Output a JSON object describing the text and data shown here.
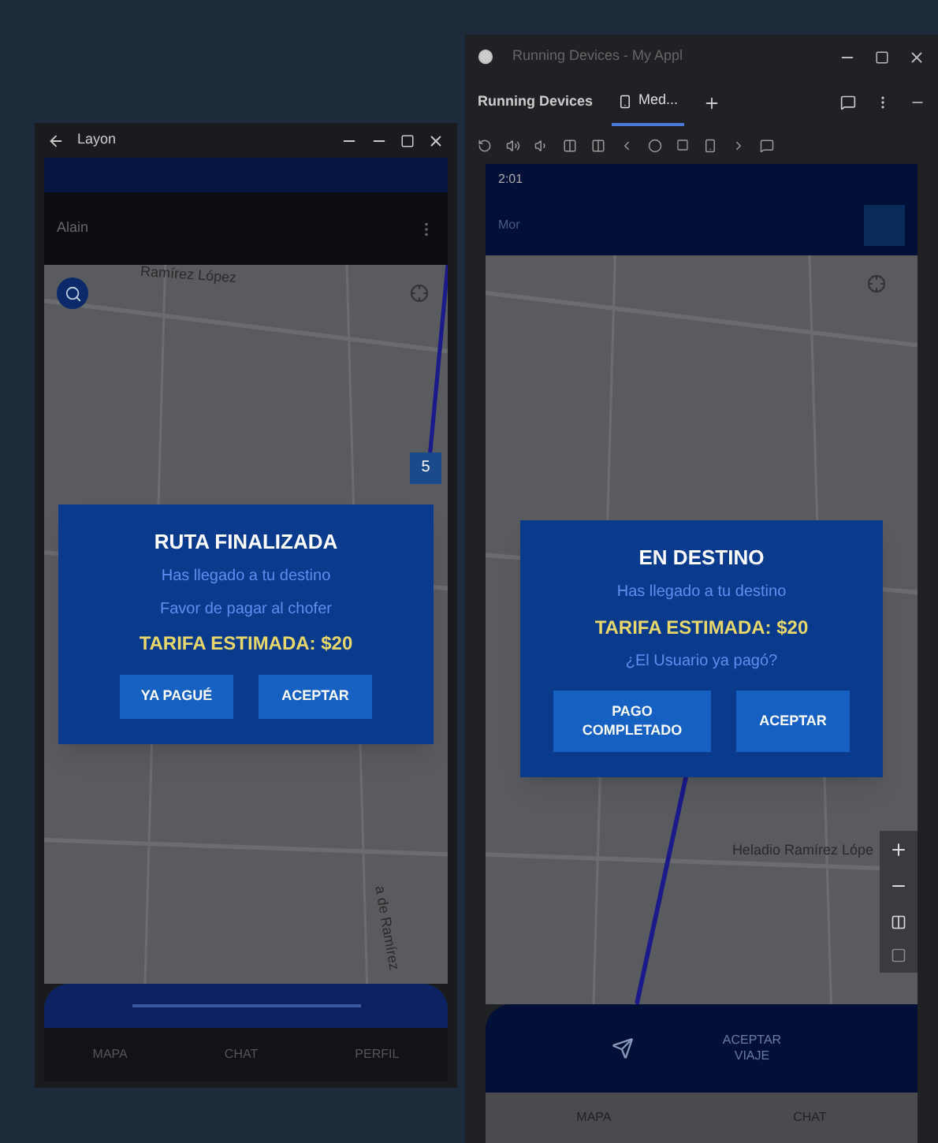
{
  "left_window": {
    "title": "Layon",
    "phone": {
      "app_bar_title": "Alain",
      "map_labels": [
        "Ramírez López",
        "a de Ramírez"
      ],
      "marker": "5",
      "dialog": {
        "title": "RUTA FINALIZADA",
        "texts": [
          {
            "kind": "info",
            "text": "Has llegado a tu destino"
          },
          {
            "kind": "info",
            "text": "Favor de pagar al chofer"
          },
          {
            "kind": "fare",
            "text": "TARIFA ESTIMADA: $20"
          }
        ],
        "buttons": [
          "YA PAGUÉ",
          "ACEPTAR"
        ]
      },
      "nav": [
        "MAPA",
        "CHAT",
        "PERFIL"
      ]
    }
  },
  "right_window": {
    "title": "Running Devices - My Appl",
    "panel_title": "Running Devices",
    "tab": {
      "label": "Med...",
      "selected": true
    },
    "phone": {
      "status_time": "2:01",
      "app_bar_title": "Mor",
      "map_labels": [
        "Heladio Ramírez Lópe"
      ],
      "dialog": {
        "title": "EN DESTINO",
        "texts": [
          {
            "kind": "info",
            "text": "Has llegado a tu destino"
          },
          {
            "kind": "fare",
            "text": "TARIFA ESTIMADA: $20"
          },
          {
            "kind": "info",
            "text": "¿El Usuario ya pagó?"
          }
        ],
        "buttons": [
          "PAGO COMPLETADO",
          "ACEPTAR"
        ]
      },
      "action": "ACEPTAR VIAJE",
      "nav": [
        "MAPA",
        "CHAT"
      ]
    }
  }
}
